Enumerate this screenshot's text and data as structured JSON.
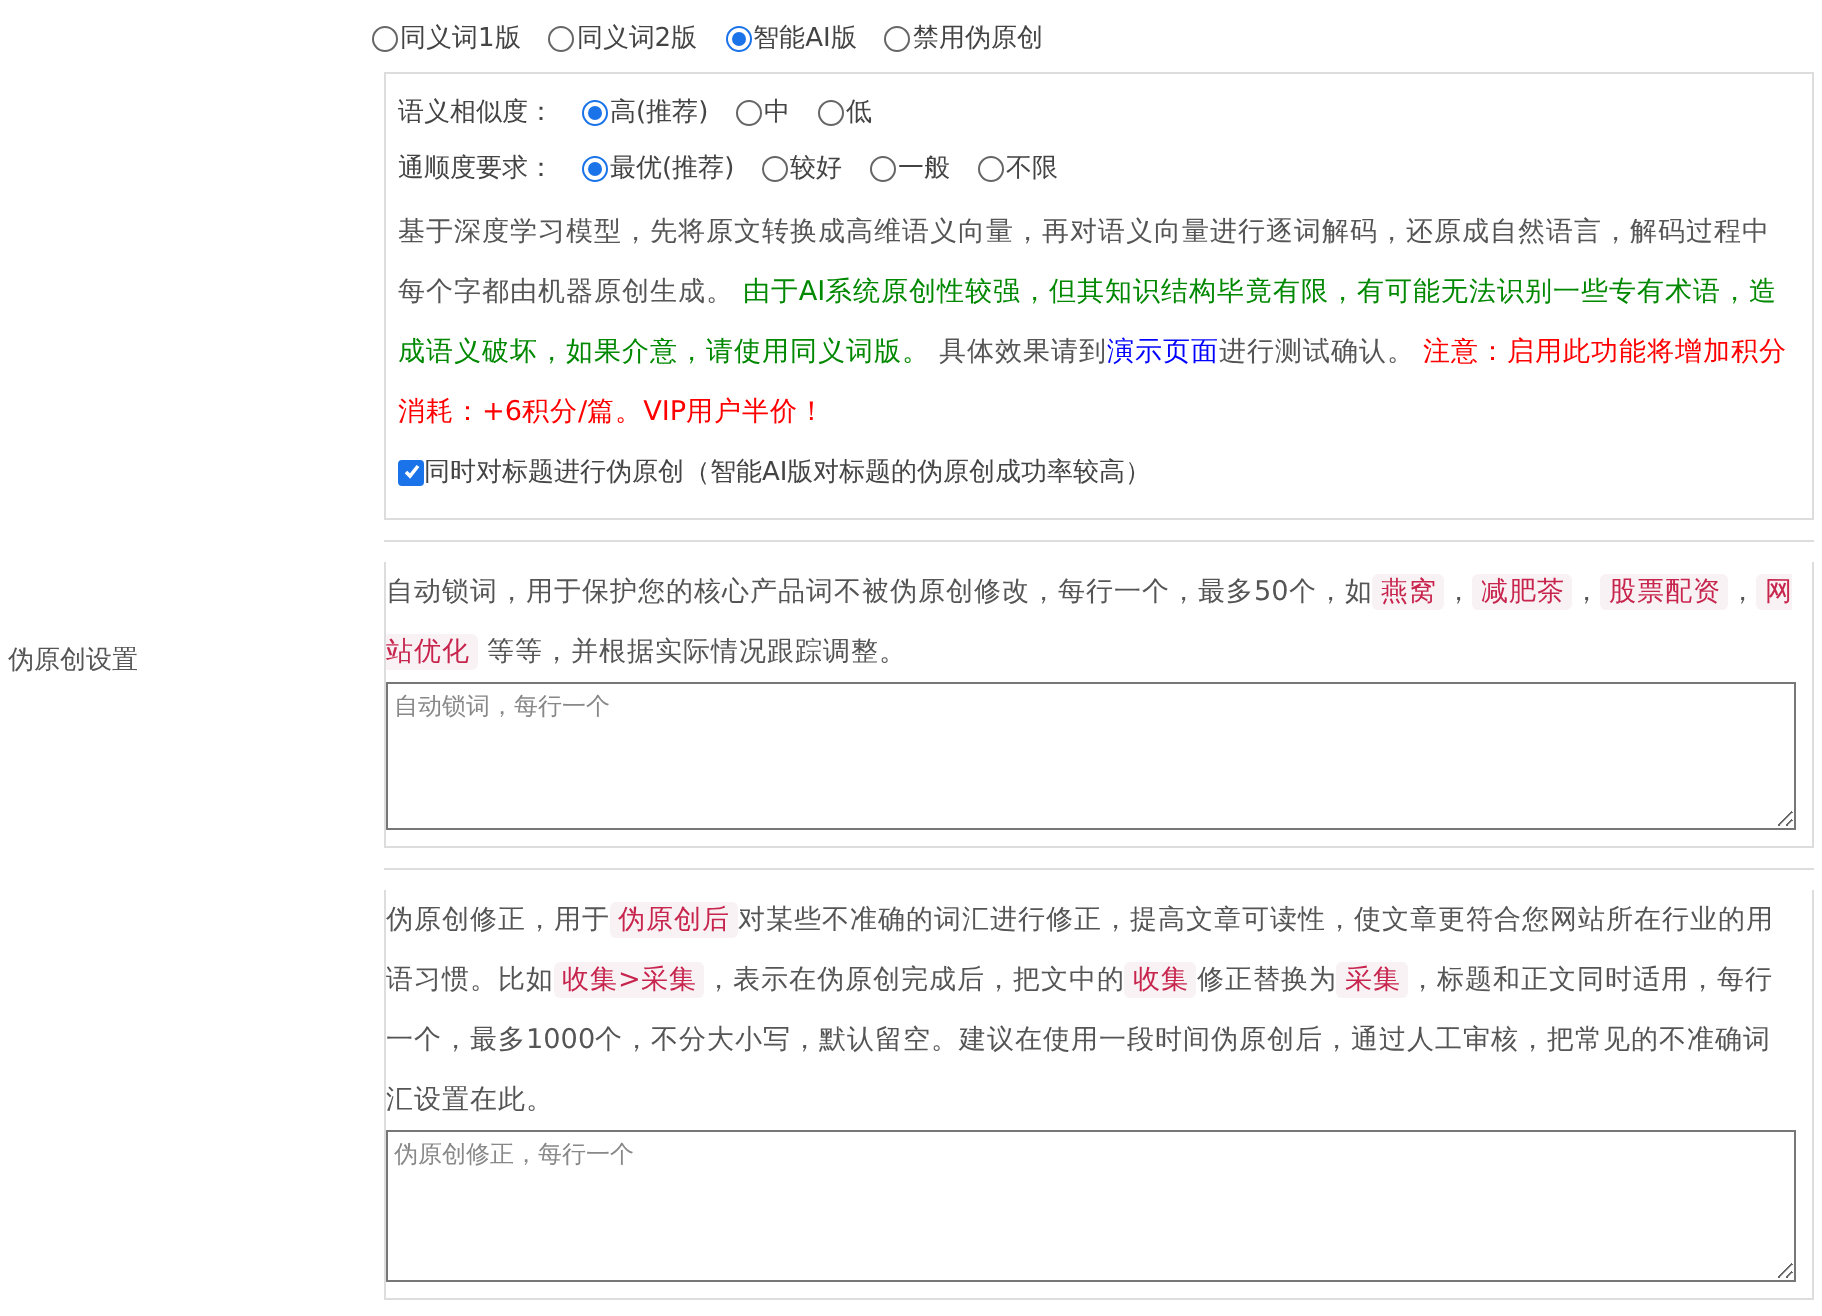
{
  "sidebar_label": "伪原创设置",
  "mode_options": [
    {
      "label": "同义词1版",
      "selected": false
    },
    {
      "label": "同义词2版",
      "selected": false
    },
    {
      "label": "智能AI版",
      "selected": true
    },
    {
      "label": "禁用伪原创",
      "selected": false
    }
  ],
  "similarity": {
    "label": "语义相似度：",
    "options": [
      {
        "label": "高(推荐)",
        "selected": true
      },
      {
        "label": "中",
        "selected": false
      },
      {
        "label": "低",
        "selected": false
      }
    ]
  },
  "fluency": {
    "label": "通顺度要求：",
    "options": [
      {
        "label": "最优(推荐)",
        "selected": true
      },
      {
        "label": "较好",
        "selected": false
      },
      {
        "label": "一般",
        "selected": false
      },
      {
        "label": "不限",
        "selected": false
      }
    ]
  },
  "ai_description": [
    {
      "kind": "plain",
      "text": "基于深度学习模型，先将原文转换成高维语义向量，再对语义向量进行逐词解码，还原成自然语言，解码过程中每个字都由机器原创生成。 "
    },
    {
      "kind": "success",
      "text": "由于AI系统原创性较强，但其知识结构毕竟有限，有可能无法识别一些专有术语，造成语义破坏，如果介意，请使用同义词版。"
    },
    {
      "kind": "plain",
      "text": " 具体效果请到"
    },
    {
      "kind": "link",
      "text": "演示页面"
    },
    {
      "kind": "plain",
      "text": "进行测试确认。 "
    },
    {
      "kind": "warning",
      "text": "注意：启用此功能将增加积分消耗：+6积分/篇。VIP用户半价！"
    }
  ],
  "title_option": {
    "label": "同时对标题进行伪原创（智能AI版对标题的伪原创成功率较高）",
    "checked": true
  },
  "lock_words": {
    "description": [
      {
        "kind": "plain",
        "text": "自动锁词，用于保护您的核心产品词不被伪原创修改，每行一个，最多50个，如"
      },
      {
        "kind": "tag",
        "text": "燕窝"
      },
      {
        "kind": "plain",
        "text": "，"
      },
      {
        "kind": "tag",
        "text": "减肥茶"
      },
      {
        "kind": "plain",
        "text": "，"
      },
      {
        "kind": "tag",
        "text": "股票配资"
      },
      {
        "kind": "plain",
        "text": "，"
      },
      {
        "kind": "tag",
        "text": "网站优化"
      },
      {
        "kind": "plain",
        "text": " 等等，并根据实际情况跟踪调整。"
      }
    ],
    "placeholder": "自动锁词，每行一个"
  },
  "correction": {
    "description": [
      {
        "kind": "plain",
        "text": "伪原创修正，用于"
      },
      {
        "kind": "tag",
        "text": "伪原创后"
      },
      {
        "kind": "plain",
        "text": "对某些不准确的词汇进行修正，提高文章可读性，使文章更符合您网站所在行业的用语习惯。比如"
      },
      {
        "kind": "tag",
        "text": "收集>采集"
      },
      {
        "kind": "plain",
        "text": "，表示在伪原创完成后，把文中的"
      },
      {
        "kind": "tag",
        "text": "收集"
      },
      {
        "kind": "plain",
        "text": "修正替换为"
      },
      {
        "kind": "tag",
        "text": "采集"
      },
      {
        "kind": "plain",
        "text": "，标题和正文同时适用，每行一个，最多1000个，不分大小写，默认留空。建议在使用一段时间伪原创后，通过人工审核，把常见的不准确词汇设置在此。"
      }
    ],
    "placeholder": "伪原创修正，每行一个"
  }
}
